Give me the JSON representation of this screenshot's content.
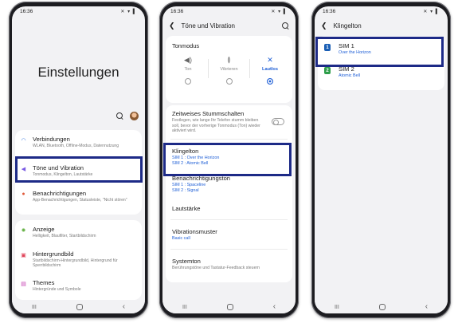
{
  "status_time": "16:36",
  "status_icons": "✕ ▾ ▌",
  "nav": {
    "recent": "III",
    "back": "‹"
  },
  "phone1": {
    "title": "Einstellungen",
    "items": [
      {
        "title": "Verbindungen",
        "sub": "WLAN, Bluetooth, Offline-Modus, Datennutzung",
        "icon": "wifi-icon",
        "color": "#3a7be0"
      },
      {
        "title": "Töne und Vibration",
        "sub": "Tonmodus, Klingelton, Lautstärke",
        "icon": "speaker-icon",
        "color": "#7a5be3"
      },
      {
        "title": "Benachrichtigungen",
        "sub": "App-Benachrichtigungen, Statusleiste, \"Nicht stören\"",
        "icon": "notification-icon",
        "color": "#e05a3a"
      },
      {
        "title": "Anzeige",
        "sub": "Helligkeit, Blaufilter, Startbildschirm",
        "icon": "brightness-icon",
        "color": "#6ab34a"
      },
      {
        "title": "Hintergrundbild",
        "sub": "Startbildschirm-Hintergrundbild, Hintergrund für Sperrbildschirm",
        "icon": "wallpaper-icon",
        "color": "#e0445a"
      },
      {
        "title": "Themes",
        "sub": "Hintergründe und Symbole",
        "icon": "themes-icon",
        "color": "#c43bb0"
      }
    ]
  },
  "phone2": {
    "header": "Töne und Vibration",
    "tonmodus": "Tonmodus",
    "modes": [
      {
        "label": "Ton",
        "selected": false
      },
      {
        "label": "Vibrieren",
        "selected": false
      },
      {
        "label": "Lautlos",
        "selected": true
      }
    ],
    "mute": {
      "title": "Zeitweises Stummschalten",
      "sub": "Festlegen, wie lange Ihr Telefon stumm bleiben soll, bevor der vorherige Tonmodus (Ton) wieder aktiviert wird."
    },
    "klingelton": {
      "title": "Klingelton",
      "sim1": "SIM 1 : Over the Horizon",
      "sim2": "SIM 2 : Atomic Bell"
    },
    "benachrichtigungston": {
      "title": "Benachrichtigungston",
      "sim1": "SIM 1 : Spaceline",
      "sim2": "SIM 2 : Signal"
    },
    "lautstaerke": "Lautstärke",
    "vibration": {
      "title": "Vibrationsmuster",
      "value": "Basic call"
    },
    "systemton": {
      "title": "Systemton",
      "sub": "Berührungstöne und Tastatur-Feedback steuern"
    }
  },
  "phone3": {
    "header": "Klingelton",
    "sims": [
      {
        "badge": "1",
        "title": "SIM 1",
        "tone": "Over the Horizon"
      },
      {
        "badge": "2",
        "title": "SIM 2",
        "tone": "Atomic Bell"
      }
    ]
  },
  "colors": {
    "highlight": "#1d2a87",
    "accent": "#1f5fd6"
  }
}
